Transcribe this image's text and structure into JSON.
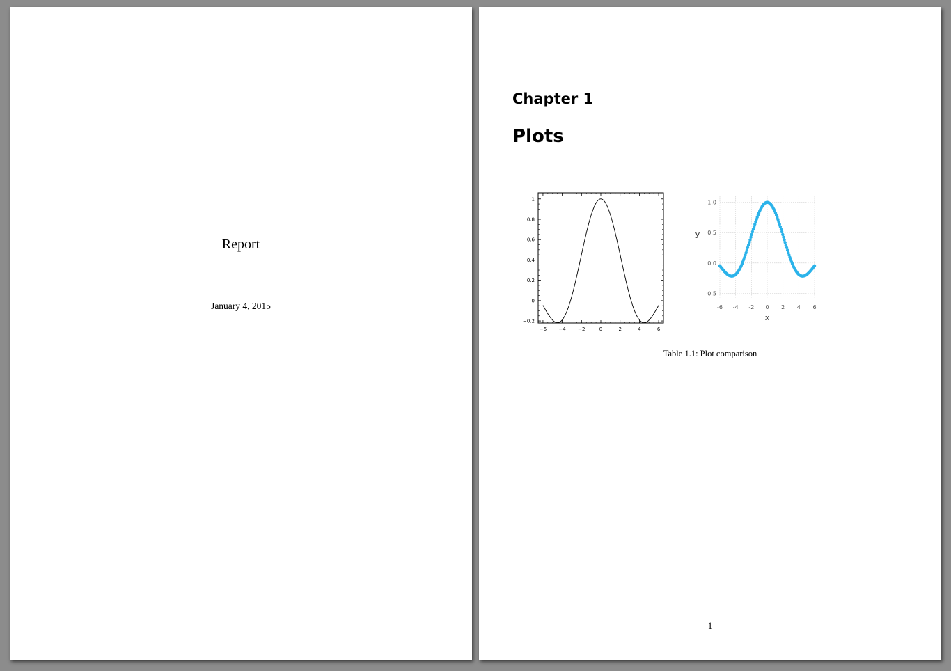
{
  "pages": [
    {
      "title": "Report",
      "date": "January 4, 2015"
    },
    {
      "chapter_label": "Chapter 1",
      "chapter_title": "Plots",
      "caption": "Table 1.1: Plot comparison",
      "page_number": "1"
    }
  ],
  "chart_data": [
    {
      "type": "line",
      "function": "sin(x)/x",
      "x": [
        -6,
        -5.5,
        -5,
        -4.5,
        -4,
        -3.5,
        -3,
        -2.5,
        -2,
        -1.5,
        -1,
        -0.5,
        0,
        0.5,
        1,
        1.5,
        2,
        2.5,
        3,
        3.5,
        4,
        4.5,
        5,
        5.5,
        6
      ],
      "y": [
        -0.047,
        -0.128,
        -0.192,
        -0.217,
        -0.189,
        -0.1,
        0.047,
        0.239,
        0.455,
        0.665,
        0.841,
        0.959,
        1.0,
        0.959,
        0.841,
        0.665,
        0.455,
        0.239,
        0.047,
        -0.1,
        -0.189,
        -0.217,
        -0.192,
        -0.128,
        -0.047
      ],
      "xlim": [
        -6.5,
        6.5
      ],
      "ylim": [
        -0.22,
        1.06
      ],
      "xticks": [
        -6,
        -4,
        -2,
        0,
        2,
        4,
        6
      ],
      "xtick_labels": [
        "−6",
        "−4",
        "−2",
        "0",
        "2",
        "4",
        "6"
      ],
      "yticks": [
        -0.2,
        0,
        0.2,
        0.4,
        0.6,
        0.8,
        1
      ],
      "ytick_labels": [
        "−0.2",
        "0",
        "0.2",
        "0.4",
        "0.6",
        "0.8",
        "1"
      ],
      "grid": false,
      "color": "#000000"
    },
    {
      "type": "scatter",
      "function": "sin(x)/x",
      "xmin": -6,
      "xmax": 6,
      "n_points": 120,
      "xlim": [
        -6,
        6
      ],
      "ylim": [
        -0.6,
        1.1
      ],
      "xticks": [
        -6,
        -4,
        -2,
        0,
        2,
        4,
        6
      ],
      "xtick_labels": [
        "-6",
        "-4",
        "-2",
        "0",
        "2",
        "4",
        "6"
      ],
      "yticks": [
        -0.5,
        0,
        0.5,
        1
      ],
      "ytick_labels": [
        "-0.5",
        "0.0",
        "0.5",
        "1.0"
      ],
      "xlabel": "x",
      "ylabel": "y",
      "grid": true,
      "color": "#2bb3ea"
    }
  ]
}
